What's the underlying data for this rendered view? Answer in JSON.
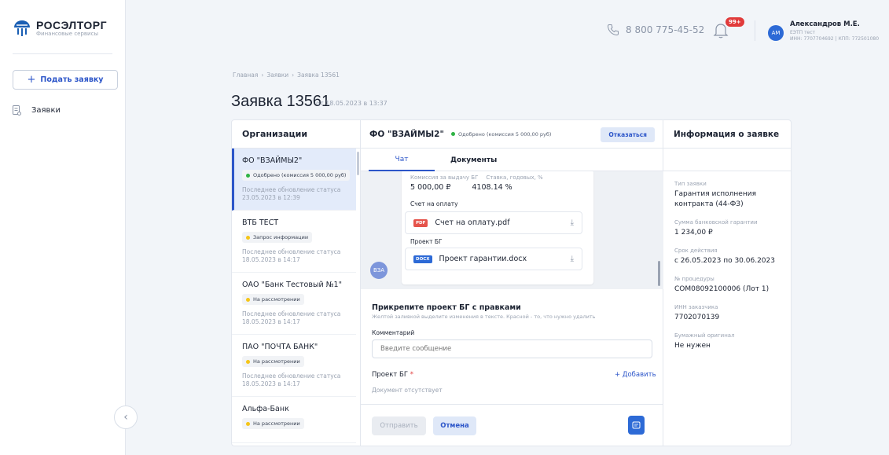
{
  "brand": {
    "name": "РОСЭЛТОРГ",
    "tagline": "Финансовые сервисы"
  },
  "sidebar": {
    "new_request_label": "Подать заявку",
    "nav": [
      {
        "label": "Заявки"
      }
    ]
  },
  "header": {
    "phone": "8 800 775-45-52",
    "notifications_badge": "99+",
    "user": {
      "initials": "АМ",
      "name": "Александров М.Е.",
      "org": "ЕЭТП тест",
      "inn_kpp": "ИНН: 7707704692 | КПП: 772501080"
    }
  },
  "breadcrumb": [
    "Главная",
    "Заявки",
    "Заявка 13561"
  ],
  "page": {
    "title": "Заявка 13561",
    "date": "от 18.05.2023 в 13:37"
  },
  "orgs": {
    "heading": "Организации",
    "items": [
      {
        "name": "ФО \"ВЗАЙМЫ2\"",
        "status": "Одобрено (комиссия 5 000,00 руб)",
        "status_color": "#2fb344",
        "updated_label": "Последнее обновление статуса",
        "updated": "23.05.2023 в 12:39"
      },
      {
        "name": "ВТБ ТЕСТ",
        "status": "Запрос информации",
        "status_color": "#f5c518",
        "updated_label": "Последнее обновление статуса",
        "updated": "18.05.2023 в 14:17"
      },
      {
        "name": "ОАО \"Банк Тестовый №1\"",
        "status": "На рассмотрении",
        "status_color": "#f5c518",
        "updated_label": "Последнее обновление статуса",
        "updated": "18.05.2023 в 14:17"
      },
      {
        "name": "ПАО \"ПОЧТА БАНК\"",
        "status": "На рассмотрении",
        "status_color": "#f5c518",
        "updated_label": "Последнее обновление статуса",
        "updated": "18.05.2023 в 14:17"
      },
      {
        "name": "Альфа-Банк",
        "status": "На рассмотрении",
        "status_color": "#f5c518"
      }
    ]
  },
  "chat": {
    "org_title": "ФО \"ВЗАЙМЫ2\"",
    "status": "Одобрено (комиссия 5 000,00 руб)",
    "refuse_label": "Отказаться",
    "tabs": [
      "Чат",
      "Документы"
    ],
    "message": {
      "fee_label": "Комиссия за выдачу БГ",
      "fee_value": "5 000,00 ₽",
      "rate_label": "Ставка, годовых, %",
      "rate_value": "4108.14 %",
      "invoice_label": "Счет на оплату",
      "invoice_file": {
        "type": "PDF",
        "name": "Счет на оплату.pdf"
      },
      "project_label": "Проект БГ",
      "project_file": {
        "type": "DOCX",
        "name": "Проект гарантии.docx"
      }
    },
    "sender_initials": "ВЗА",
    "form": {
      "title": "Прикрепите проект БГ с правками",
      "hint": "Желтой заливкой выделите изменения в тексте. Красной - то, что нужно удалить",
      "comment_label": "Комментарий",
      "comment_placeholder": "Введите сообщение",
      "project_label": "Проект БГ",
      "required_mark": "*",
      "add_label": "+ Добавить",
      "no_doc": "Документ отсутствует",
      "send_label": "Отправить",
      "cancel_label": "Отмена"
    }
  },
  "info": {
    "heading": "Информация о заявке",
    "fields": [
      {
        "label": "Тип заявки",
        "value": "Гарантия исполнения контракта (44-ФЗ)"
      },
      {
        "label": "Сумма банковской гарантии",
        "value": "1 234,00 ₽"
      },
      {
        "label": "Срок действия",
        "value": "с 26.05.2023 по 30.06.2023"
      },
      {
        "label": "№ процедуры",
        "value": "COM08092100006 (Лот 1)"
      },
      {
        "label": "ИНН заказчика",
        "value": "7702070139"
      },
      {
        "label": "Бумажный оригинал",
        "value": "Не нужен"
      }
    ]
  },
  "colors": {
    "accent": "#2d56c9",
    "approved": "#2fb344",
    "pending": "#f5c518",
    "badge": "#e13b3b"
  }
}
